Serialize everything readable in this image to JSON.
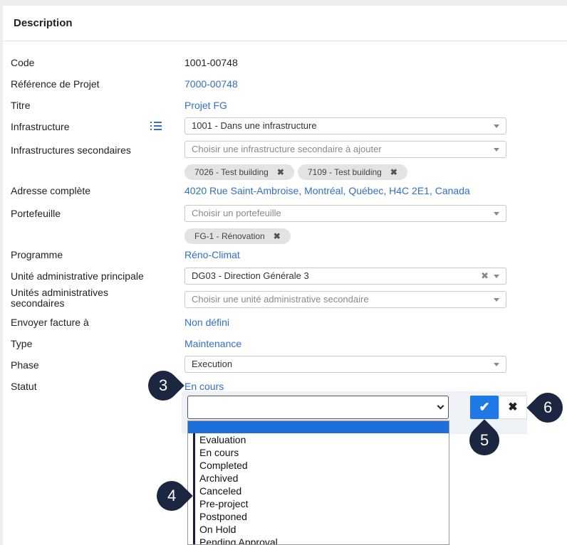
{
  "header": {
    "title": "Description"
  },
  "fields": {
    "code": {
      "label": "Code",
      "value": "1001-00748"
    },
    "project_ref": {
      "label": "Référence de Projet",
      "value": "7000-00748"
    },
    "title": {
      "label": "Titre",
      "value": "Projet FG"
    },
    "infrastructure": {
      "label": "Infrastructure",
      "value": "1001 - Dans une infrastructure"
    },
    "secondary_infra": {
      "label": "Infrastructures secondaires",
      "placeholder": "Choisir une infrastructure secondaire à ajouter",
      "tags": [
        "7026 - Test building",
        "7109 - Test building"
      ]
    },
    "address": {
      "label": "Adresse complète",
      "value": "4020 Rue Saint-Ambroise, Montréal, Québec, H4C 2E1, Canada"
    },
    "portfolio": {
      "label": "Portefeuille",
      "placeholder": "Choisir un portefeuille",
      "tags": [
        "FG-1 - Rénovation"
      ]
    },
    "program": {
      "label": "Programme",
      "value": "Réno-Climat"
    },
    "main_admin_unit": {
      "label": "Unité administrative principale",
      "value": "DG03 - Direction Générale 3"
    },
    "secondary_admin_units": {
      "label_line1": "Unités administratives",
      "label_line2": "secondaires",
      "placeholder": "Choisir une unité administrative secondaire"
    },
    "invoice_to": {
      "label": "Envoyer facture à",
      "value": "Non défini"
    },
    "type": {
      "label": "Type",
      "value": "Maintenance"
    },
    "phase": {
      "label": "Phase",
      "value": "Execution"
    },
    "status": {
      "label": "Statut",
      "value": "En cours"
    }
  },
  "status_dropdown": {
    "selected": "",
    "options": [
      "Evaluation",
      "En cours",
      "Completed",
      "Archived",
      "Canceled",
      "Pre-project",
      "Postponed",
      "On Hold",
      "Pending Approval"
    ]
  },
  "actions": {
    "confirm_glyph": "✔",
    "cancel_glyph": "✖"
  },
  "tag_remove_glyph": "✖",
  "markers": [
    "3",
    "4",
    "5",
    "6"
  ],
  "colors": {
    "link": "#2f6fd6",
    "primary": "#1e78e6",
    "marker": "#1b2640"
  }
}
